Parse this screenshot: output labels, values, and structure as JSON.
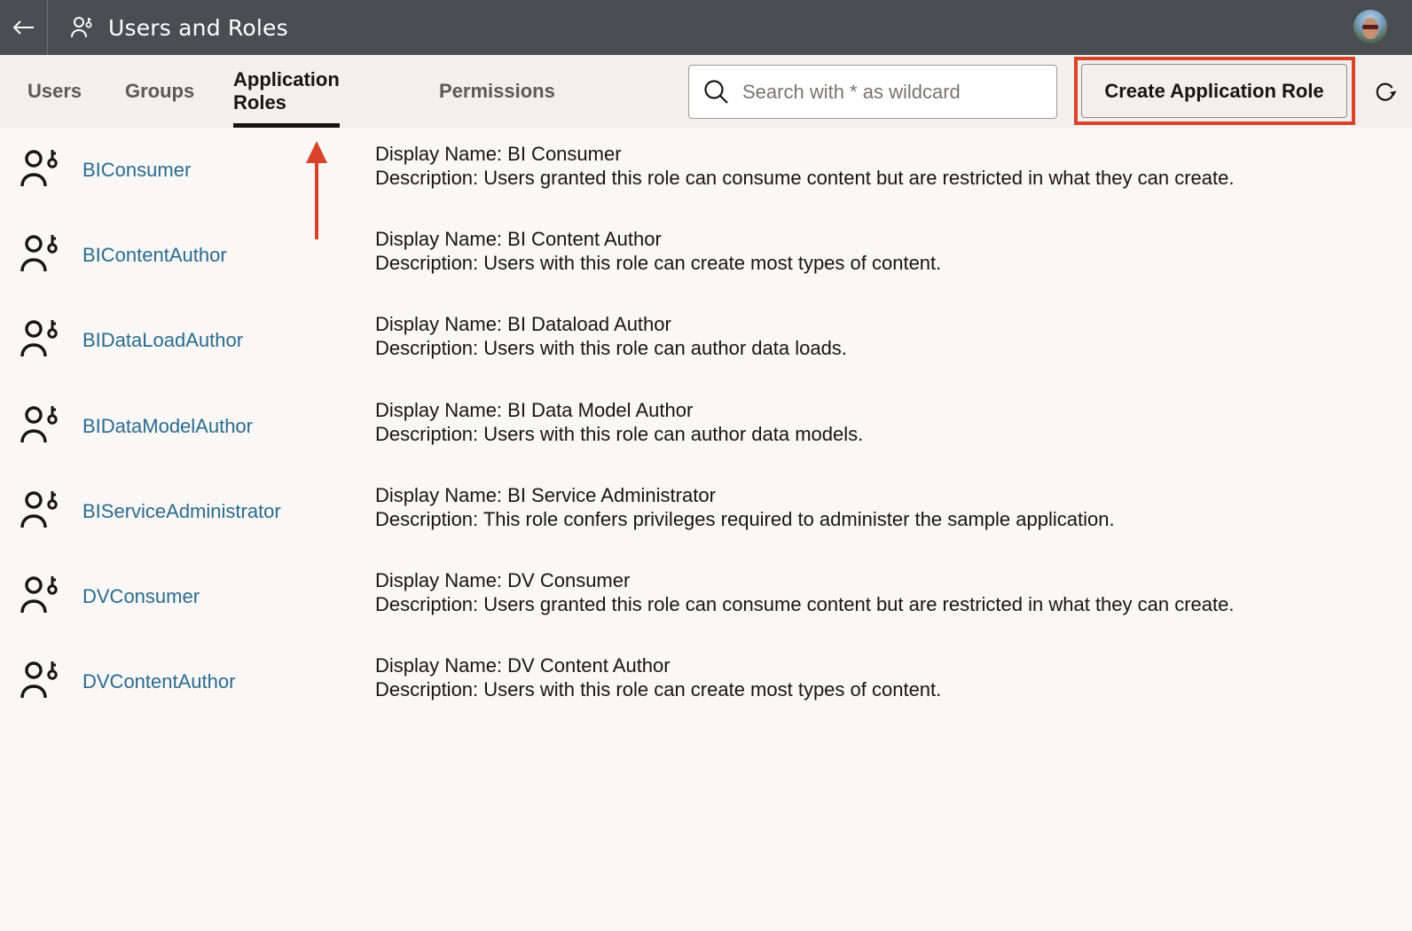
{
  "header": {
    "back_icon": "arrow-left-icon",
    "app_icon": "user-key-icon",
    "title": "Users and Roles",
    "avatar": "user-avatar"
  },
  "tabs": [
    {
      "label": "Users",
      "active": false
    },
    {
      "label": "Groups",
      "active": false
    },
    {
      "label": "Application Roles",
      "active": true
    },
    {
      "label": "Permissions",
      "active": false
    }
  ],
  "search": {
    "icon": "search-icon",
    "value": "",
    "placeholder": "Search with * as wildcard"
  },
  "toolbar": {
    "create_label": "Create Application Role",
    "refresh_icon": "refresh-icon"
  },
  "annotations": {
    "highlight_color": "#d9432a",
    "arrow_color": "#d9432a"
  },
  "colors": {
    "header_bg": "#4a4d52",
    "link": "#2b6a8e",
    "toolbar_bg": "#f1f0ee",
    "page_bg": "#f9f8f7"
  },
  "roles": [
    {
      "name": "BIConsumer",
      "display_name": "Display Name: BI Consumer",
      "description": "Description: Users granted this role can consume content but are restricted in what they can create."
    },
    {
      "name": "BIContentAuthor",
      "display_name": "Display Name: BI Content Author",
      "description": "Description: Users with this role can create most types of content."
    },
    {
      "name": "BIDataLoadAuthor",
      "display_name": "Display Name: BI Dataload Author",
      "description": "Description: Users with this role can author data loads."
    },
    {
      "name": "BIDataModelAuthor",
      "display_name": "Display Name: BI Data Model Author",
      "description": "Description: Users with this role can author data models."
    },
    {
      "name": "BIServiceAdministrator",
      "display_name": "Display Name: BI Service Administrator",
      "description": "Description: This role confers privileges required to administer the sample application."
    },
    {
      "name": "DVConsumer",
      "display_name": "Display Name: DV Consumer",
      "description": "Description: Users granted this role can consume content but are restricted in what they can create."
    },
    {
      "name": "DVContentAuthor",
      "display_name": "Display Name: DV Content Author",
      "description": "Description: Users with this role can create most types of content."
    }
  ]
}
